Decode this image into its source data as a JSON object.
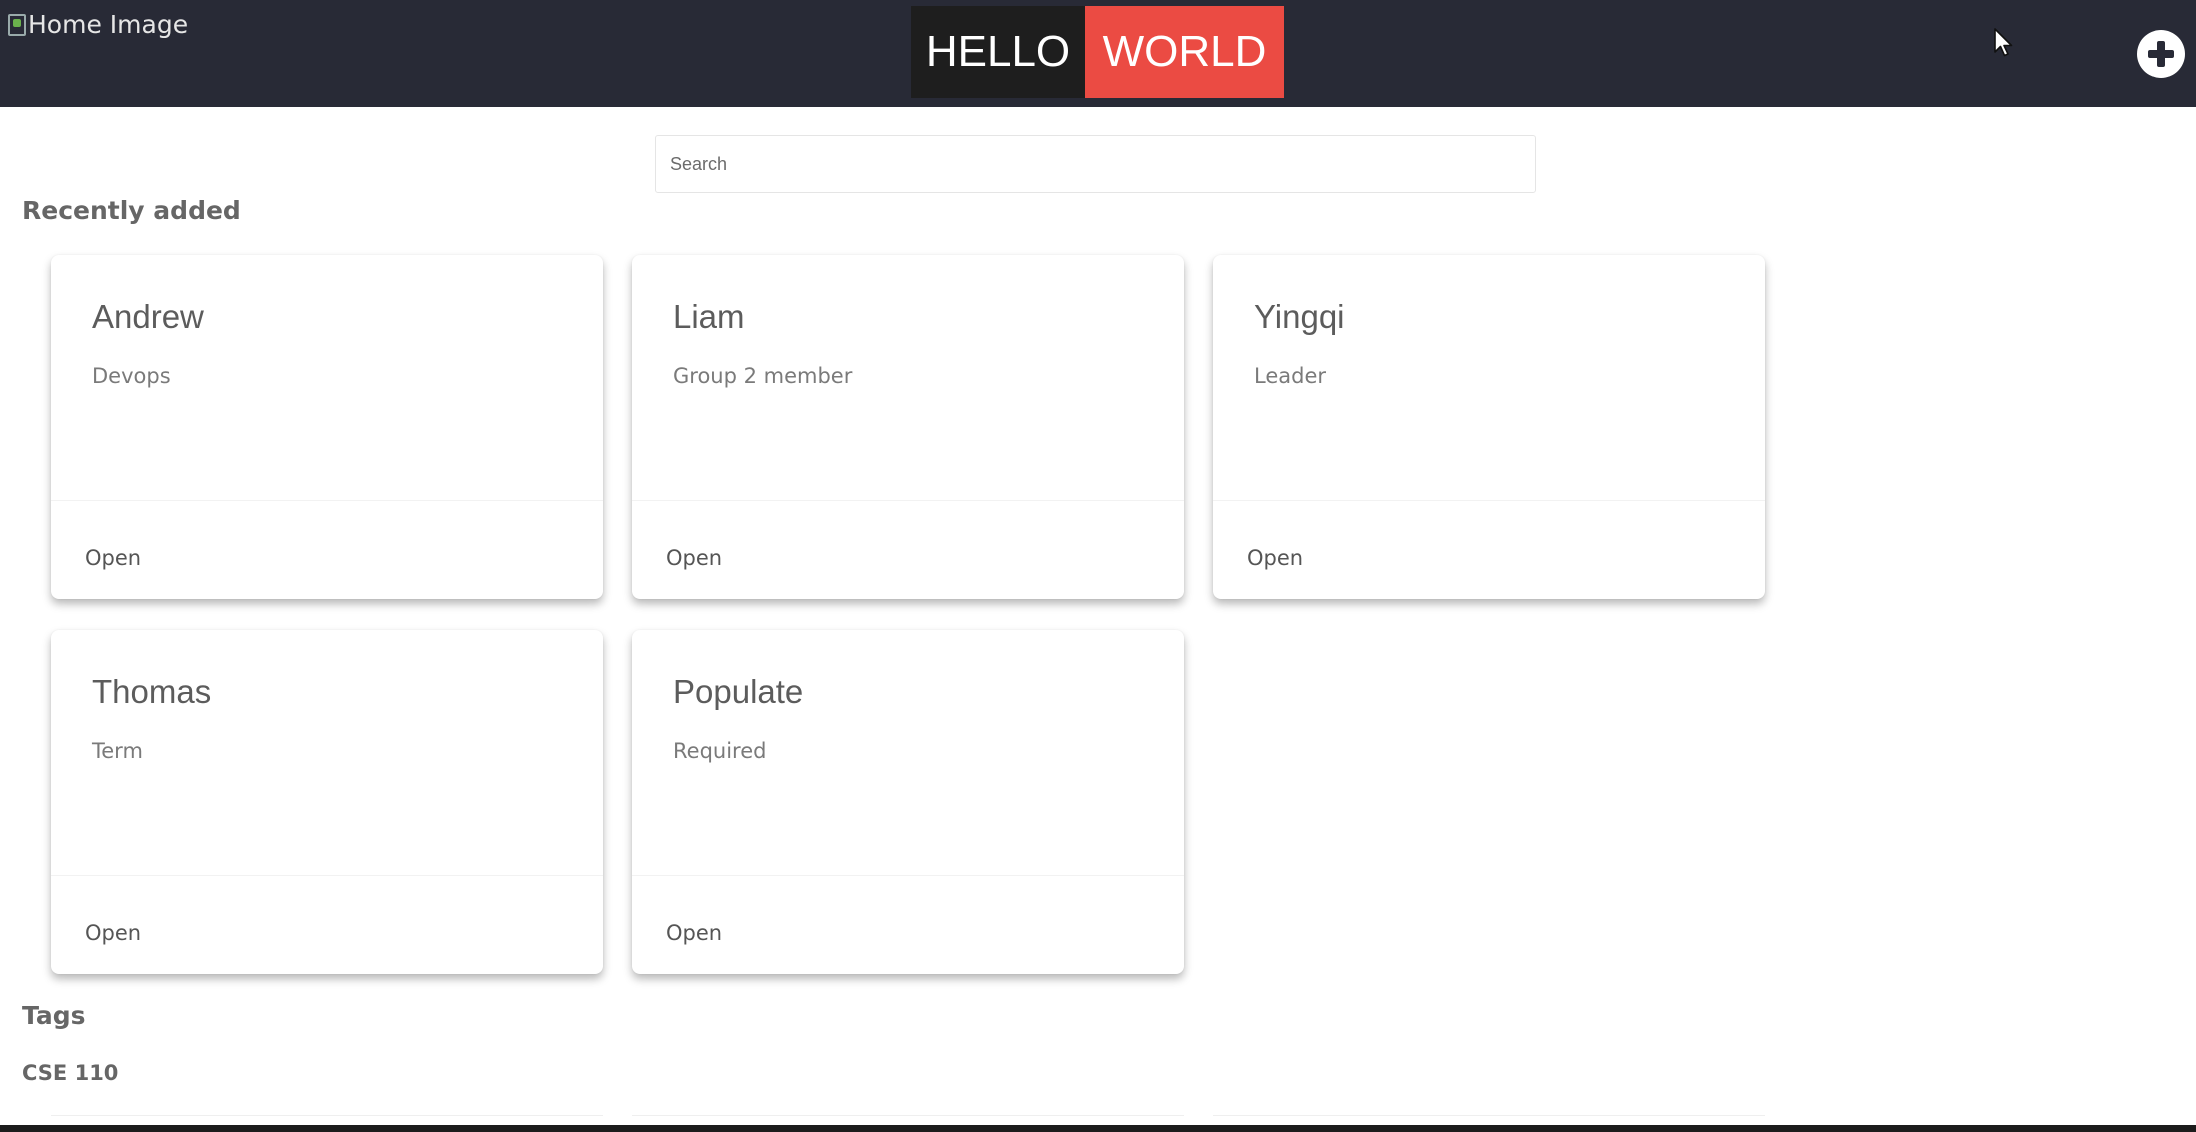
{
  "header": {
    "home_image_alt": "Home Image",
    "logo_hello": "HELLO",
    "logo_world": "WORLD",
    "add_icon": "plus-circle-icon"
  },
  "search": {
    "placeholder": "Search",
    "value": ""
  },
  "recently_added": {
    "heading": "Recently added",
    "cards": [
      {
        "title": "Andrew",
        "subtitle": "Devops",
        "action": "Open"
      },
      {
        "title": "Liam",
        "subtitle": "Group 2 member",
        "action": "Open"
      },
      {
        "title": "Yingqi",
        "subtitle": "Leader",
        "action": "Open"
      },
      {
        "title": "Thomas",
        "subtitle": "Term",
        "action": "Open"
      },
      {
        "title": "Populate",
        "subtitle": "Required",
        "action": "Open"
      }
    ]
  },
  "tags": {
    "heading": "Tags",
    "items": [
      "CSE 110"
    ]
  },
  "colors": {
    "topbar": "#282a36",
    "logo_hello_bg": "#1e1e1e",
    "logo_world_bg": "#eb4b43",
    "heading_text": "#666666"
  }
}
